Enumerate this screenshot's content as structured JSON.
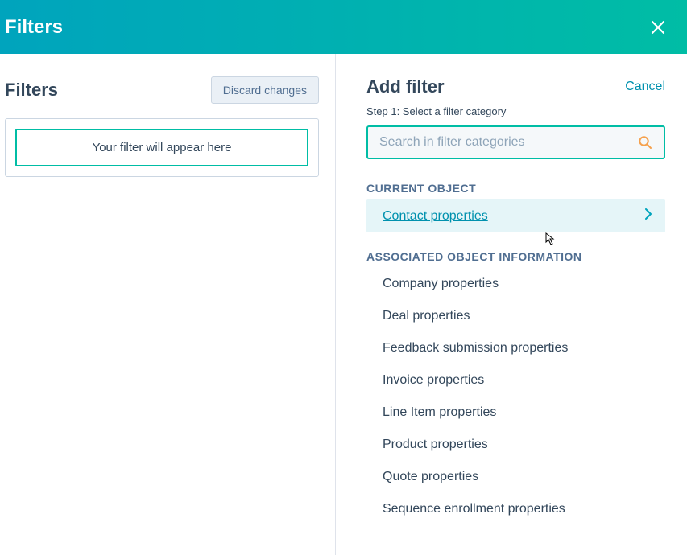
{
  "header": {
    "title": "Filters"
  },
  "left": {
    "title": "Filters",
    "discard_label": "Discard changes",
    "placeholder_text": "Your filter will appear here"
  },
  "right": {
    "title": "Add filter",
    "cancel_label": "Cancel",
    "step_text": "Step 1: Select a filter category",
    "search_placeholder": "Search in filter categories",
    "sections": {
      "current": {
        "header": "CURRENT OBJECT",
        "items": [
          "Contact properties"
        ]
      },
      "associated": {
        "header": "ASSOCIATED OBJECT INFORMATION",
        "items": [
          "Company properties",
          "Deal properties",
          "Feedback submission properties",
          "Invoice properties",
          "Line Item properties",
          "Product properties",
          "Quote properties",
          "Sequence enrollment properties"
        ]
      }
    }
  },
  "colors": {
    "accent": "#00a4bd",
    "accent2": "#00bda5"
  }
}
